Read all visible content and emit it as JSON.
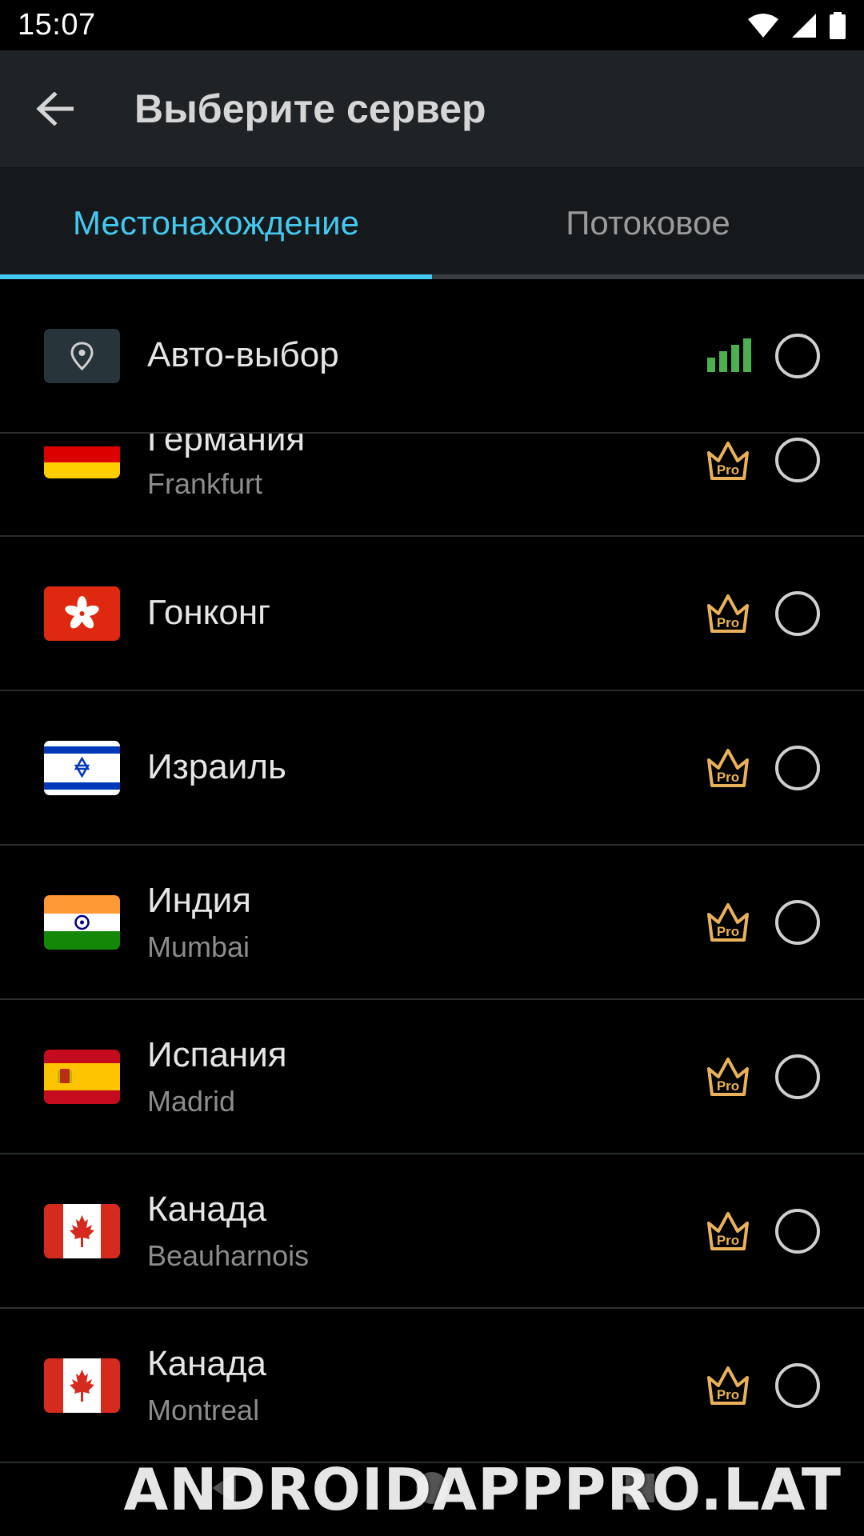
{
  "status_bar": {
    "time": "15:07"
  },
  "toolbar": {
    "title": "Выберите сервер"
  },
  "tabs": [
    {
      "label": "Местонахождение",
      "active": true
    },
    {
      "label": "Потоковое",
      "active": false
    }
  ],
  "colors": {
    "accent": "#45c8ef",
    "pro_gold": "#e8b15a",
    "signal_green": "#4caf50"
  },
  "servers": [
    {
      "title": "Авто-выбор",
      "subtitle": "",
      "flag": "location-pin",
      "badge": "signal",
      "selected": false
    },
    {
      "title": "Германия",
      "subtitle": "Frankfurt",
      "flag": "germany",
      "badge": "Pro",
      "selected": false
    },
    {
      "title": "Гонконг",
      "subtitle": "",
      "flag": "hong-kong",
      "badge": "Pro",
      "selected": false
    },
    {
      "title": "Израиль",
      "subtitle": "",
      "flag": "israel",
      "badge": "Pro",
      "selected": false
    },
    {
      "title": "Индия",
      "subtitle": "Mumbai",
      "flag": "india",
      "badge": "Pro",
      "selected": false
    },
    {
      "title": "Испания",
      "subtitle": "Madrid",
      "flag": "spain",
      "badge": "Pro",
      "selected": false
    },
    {
      "title": "Канада",
      "subtitle": "Beauharnois",
      "flag": "canada",
      "badge": "Pro",
      "selected": false
    },
    {
      "title": "Канада",
      "subtitle": "Montreal",
      "flag": "canada",
      "badge": "Pro",
      "selected": false
    }
  ],
  "pro_label": "Pro",
  "watermark": "ANDROIDAPPPRO.LAT"
}
